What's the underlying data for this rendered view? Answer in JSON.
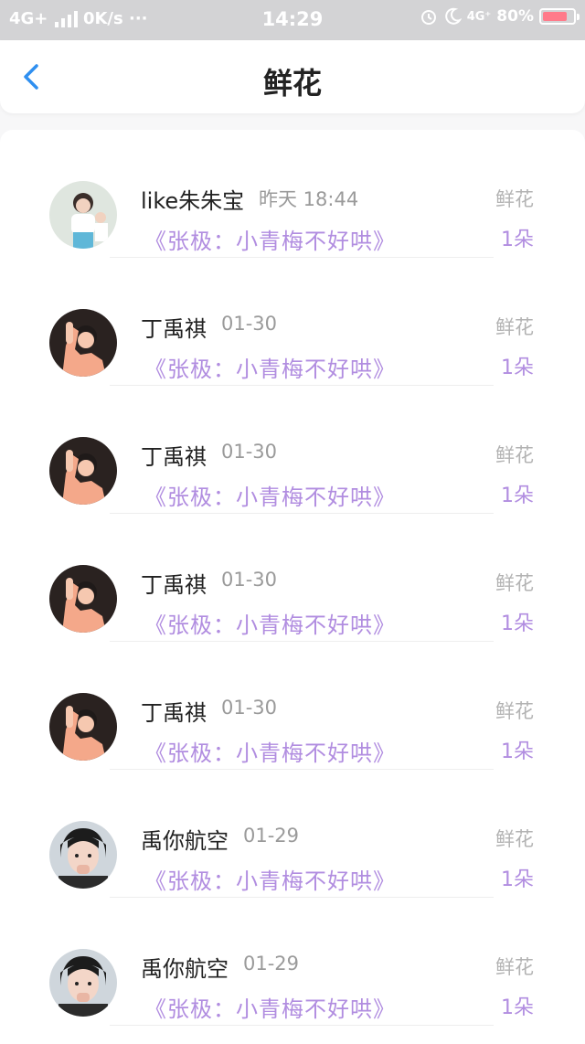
{
  "status": {
    "network": "4G+",
    "speed": "0K/s",
    "more": "···",
    "time": "14:29",
    "net_right": "4G⁺",
    "battery": "80%",
    "battery_level": 0.8
  },
  "nav": {
    "title": "鲜花"
  },
  "items": [
    {
      "name": "like朱朱宝",
      "time": "昨天 18:44",
      "book": "《张极：小青梅不好哄》",
      "gift": "鲜花",
      "count": "1朵",
      "avatar": "avatar-boy-white"
    },
    {
      "name": "丁禹祺",
      "time": "01-30",
      "book": "《张极：小青梅不好哄》",
      "gift": "鲜花",
      "count": "1朵",
      "avatar": "avatar-boy-pink"
    },
    {
      "name": "丁禹祺",
      "time": "01-30",
      "book": "《张极：小青梅不好哄》",
      "gift": "鲜花",
      "count": "1朵",
      "avatar": "avatar-boy-pink"
    },
    {
      "name": "丁禹祺",
      "time": "01-30",
      "book": "《张极：小青梅不好哄》",
      "gift": "鲜花",
      "count": "1朵",
      "avatar": "avatar-boy-pink"
    },
    {
      "name": "丁禹祺",
      "time": "01-30",
      "book": "《张极：小青梅不好哄》",
      "gift": "鲜花",
      "count": "1朵",
      "avatar": "avatar-boy-pink"
    },
    {
      "name": "禹你航空",
      "time": "01-29",
      "book": "《张极：小青梅不好哄》",
      "gift": "鲜花",
      "count": "1朵",
      "avatar": "avatar-boy-dark"
    },
    {
      "name": "禹你航空",
      "time": "01-29",
      "book": "《张极：小青梅不好哄》",
      "gift": "鲜花",
      "count": "1朵",
      "avatar": "avatar-boy-dark"
    }
  ],
  "colors": {
    "accent": "#b18de0",
    "back": "#2f8ff0"
  }
}
